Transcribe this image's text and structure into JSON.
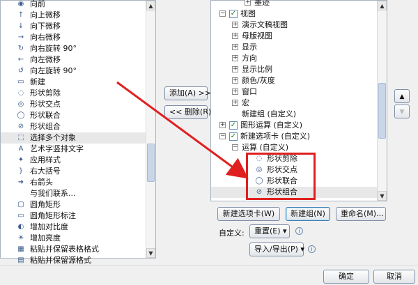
{
  "left_list": {
    "items": [
      {
        "label": "向前",
        "icon": "forward-icon"
      },
      {
        "label": "向上微移",
        "icon": "nudge-up-icon"
      },
      {
        "label": "向下微移",
        "icon": "nudge-down-icon"
      },
      {
        "label": "向右微移",
        "icon": "nudge-right-icon"
      },
      {
        "label": "向右旋转 90°",
        "icon": "rotate-right-icon"
      },
      {
        "label": "向左微移",
        "icon": "nudge-left-icon"
      },
      {
        "label": "向左旋转 90°",
        "icon": "rotate-left-icon"
      },
      {
        "label": "新建",
        "icon": "new-doc-icon"
      },
      {
        "label": "形状剪除",
        "icon": "shape-subtract-icon"
      },
      {
        "label": "形状交点",
        "icon": "shape-intersect-icon"
      },
      {
        "label": "形状联合",
        "icon": "shape-union-icon"
      },
      {
        "label": "形状组合",
        "icon": "shape-combine-icon"
      },
      {
        "label": "选择多个对象",
        "icon": "select-objects-icon"
      },
      {
        "label": "艺术字竖排文字",
        "icon": "vertical-wordart-icon"
      },
      {
        "label": "应用样式",
        "icon": "apply-style-icon"
      },
      {
        "label": "右大括号",
        "icon": "right-brace-icon"
      },
      {
        "label": "右箭头",
        "icon": "right-arrow-icon"
      },
      {
        "label": "与我们联系...",
        "icon": ""
      },
      {
        "label": "圆角矩形",
        "icon": "rounded-rect-icon"
      },
      {
        "label": "圆角矩形标注",
        "icon": "rounded-callout-icon"
      },
      {
        "label": "增加对比度",
        "icon": "contrast-up-icon"
      },
      {
        "label": "增加亮度",
        "icon": "brightness-up-icon"
      },
      {
        "label": "粘贴并保留表格格式",
        "icon": "paste-table-icon"
      },
      {
        "label": "粘贴并保留源格式",
        "icon": "paste-source-icon"
      }
    ],
    "selected_index": 12
  },
  "middle": {
    "add_button": "添加(A) >>",
    "remove_button": "<< 删除(R)"
  },
  "tree": {
    "items": [
      {
        "label": "墨迹",
        "level": 2,
        "exp": "+",
        "check": false
      },
      {
        "label": "视图",
        "level": 0,
        "exp": "−",
        "check": true
      },
      {
        "label": "演示文稿视图",
        "level": 1,
        "exp": "+",
        "check": false
      },
      {
        "label": "母版视图",
        "level": 1,
        "exp": "+",
        "check": false
      },
      {
        "label": "显示",
        "level": 1,
        "exp": "+",
        "check": false
      },
      {
        "label": "方向",
        "level": 1,
        "exp": "+",
        "check": false
      },
      {
        "label": "显示比例",
        "level": 1,
        "exp": "+",
        "check": false
      },
      {
        "label": "颜色/灰度",
        "level": 1,
        "exp": "+",
        "check": false
      },
      {
        "label": "窗口",
        "level": 1,
        "exp": "+",
        "check": false
      },
      {
        "label": "宏",
        "level": 1,
        "exp": "+",
        "check": false
      },
      {
        "label": "新建组 (自定义)",
        "level": 1,
        "exp": "",
        "check": false
      },
      {
        "label": "图形运算 (自定义)",
        "level": 0,
        "exp": "+",
        "check": true
      },
      {
        "label": "新建选项卡 (自定义)",
        "level": 0,
        "exp": "−",
        "check": true
      },
      {
        "label": "运算 (自定义)",
        "level": 1,
        "exp": "−",
        "check": false
      },
      {
        "label": "形状剪除",
        "level": 2,
        "exp": "",
        "check": false,
        "icon": "shape-subtract-icon"
      },
      {
        "label": "形状交点",
        "level": 2,
        "exp": "",
        "check": false,
        "icon": "shape-intersect-icon"
      },
      {
        "label": "形状联合",
        "level": 2,
        "exp": "",
        "check": false,
        "icon": "shape-union-icon"
      },
      {
        "label": "形状组合",
        "level": 2,
        "exp": "",
        "check": false,
        "icon": "shape-combine-icon"
      }
    ],
    "selected_index": 17
  },
  "bottom": {
    "new_tab": "新建选项卡(W)",
    "new_group": "新建组(N)",
    "rename": "重命名(M)...",
    "customize_label": "自定义:",
    "reset": "重置(E) ▾",
    "import_export": "导入/导出(P) ▾"
  },
  "footer": {
    "ok": "确定",
    "cancel": "取消"
  },
  "colors": {
    "arrow": "#e02020",
    "highlight": "#e02020"
  }
}
